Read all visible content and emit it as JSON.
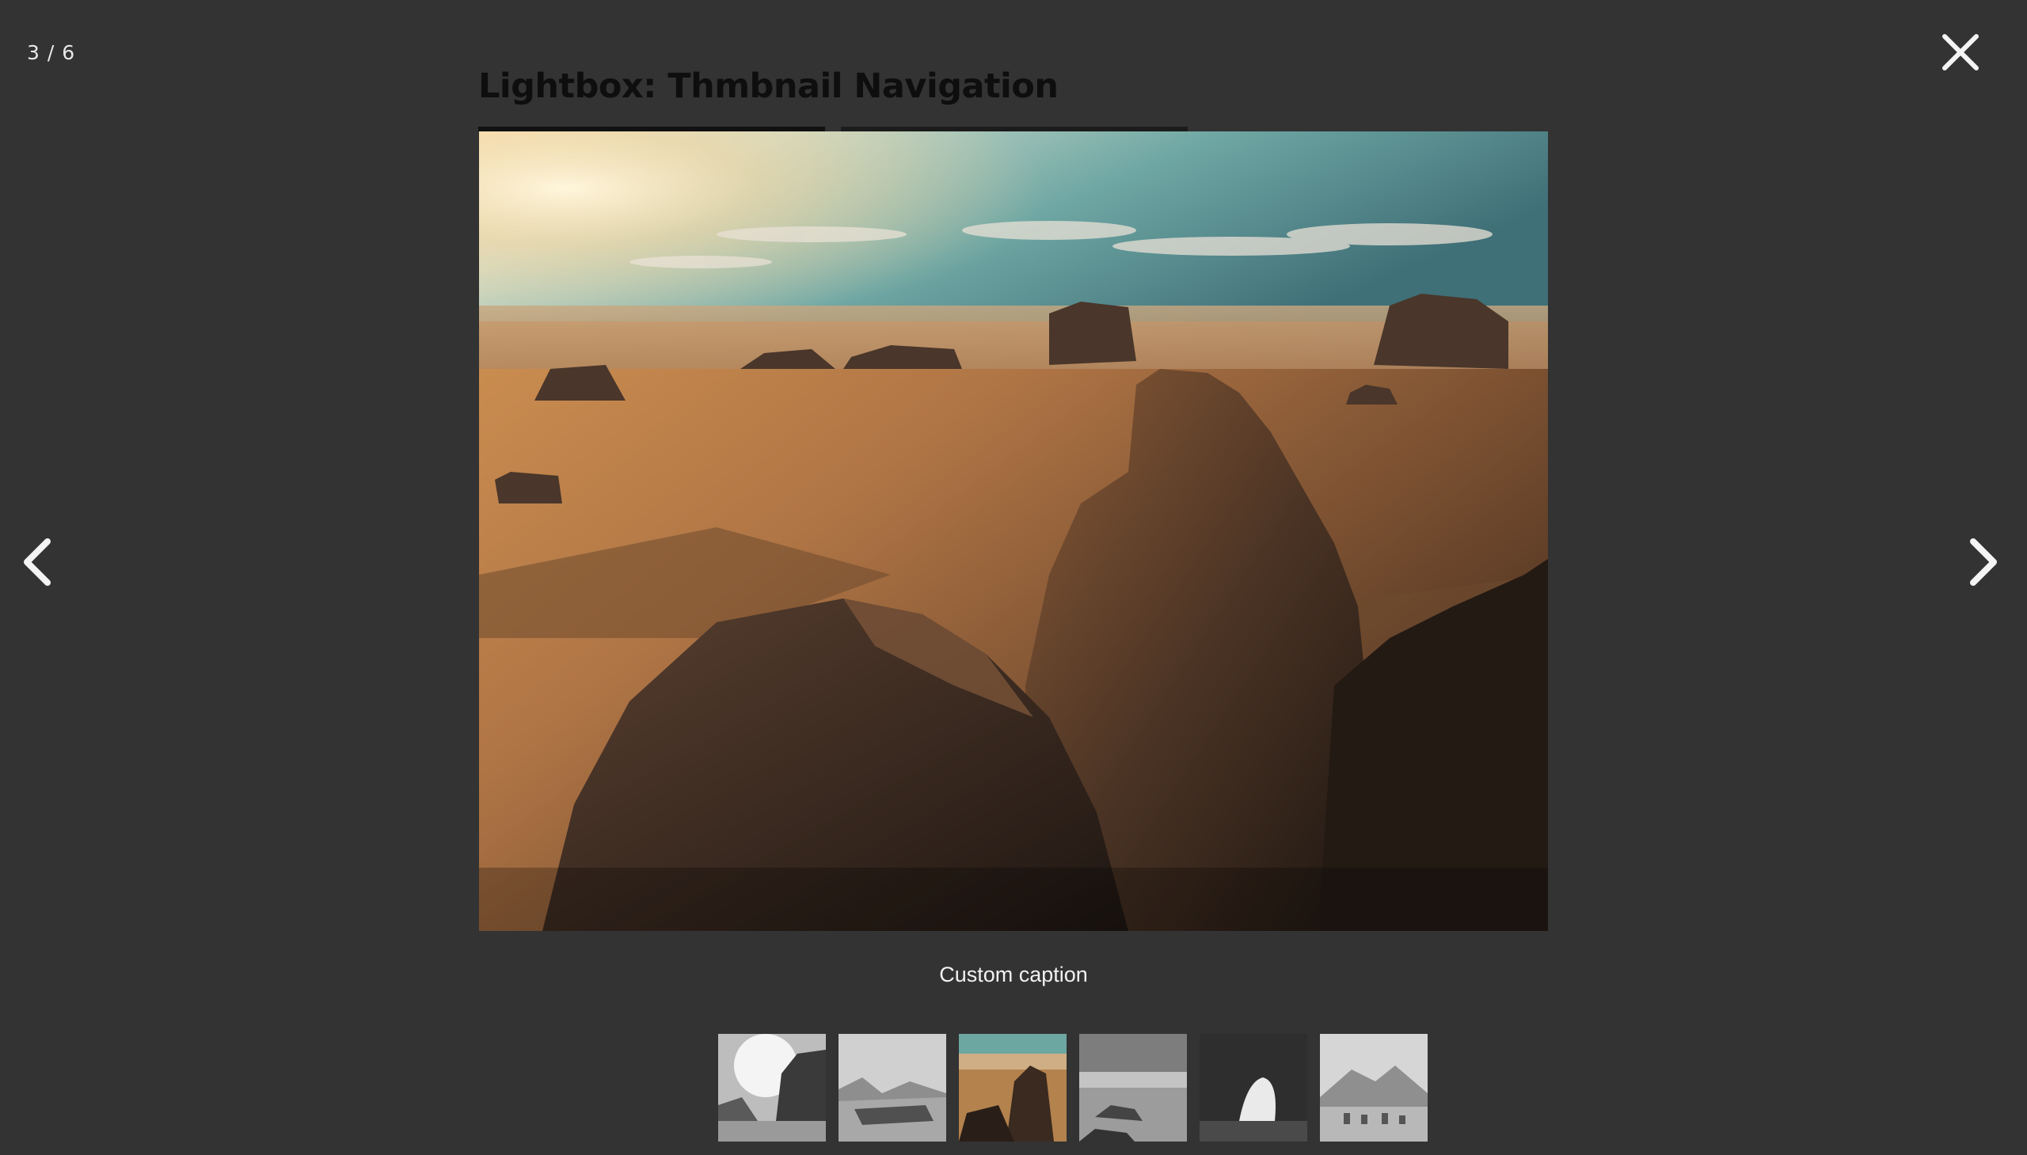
{
  "lightbox": {
    "counter": "3 / 6",
    "caption": "Custom caption",
    "close_icon": "close-icon",
    "prev_icon": "chevron-left-icon",
    "next_icon": "chevron-right-icon"
  },
  "page": {
    "title": "Lightbox: Thmbnail Navigation"
  },
  "thumbnails": [
    {
      "name": "desert-rocks-bw",
      "active": false
    },
    {
      "name": "mountains-bw",
      "active": false
    },
    {
      "name": "desert-sunset-color",
      "active": true
    },
    {
      "name": "rock-plain-bw",
      "active": false
    },
    {
      "name": "rock-arch-bw",
      "active": false
    },
    {
      "name": "camels-bw",
      "active": false
    }
  ],
  "colors": {
    "overlay_bg": "#333333",
    "text": "#f2f2f2"
  }
}
